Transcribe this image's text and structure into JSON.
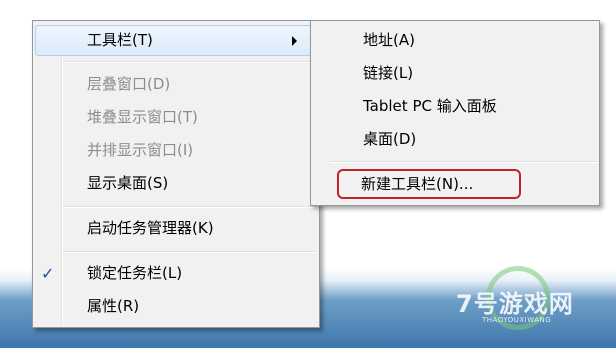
{
  "context_menu": {
    "toolbars": {
      "label": "工具栏(T)",
      "has_submenu": true
    },
    "cascade_windows": {
      "label": "层叠窗口(D)",
      "disabled": true
    },
    "stack_windows": {
      "label": "堆叠显示窗口(T)",
      "disabled": true
    },
    "side_by_side": {
      "label": "并排显示窗口(I)",
      "disabled": true
    },
    "show_desktop": {
      "label": "显示桌面(S)"
    },
    "task_manager": {
      "label": "启动任务管理器(K)"
    },
    "lock_taskbar": {
      "label": "锁定任务栏(L)",
      "check": "✓"
    },
    "properties": {
      "label": "属性(R)"
    }
  },
  "toolbars_submenu": {
    "address": {
      "label": "地址(A)"
    },
    "links": {
      "label": "链接(L)"
    },
    "tablet_input": {
      "label": "Tablet PC 输入面板"
    },
    "desktop": {
      "label": "桌面(D)"
    },
    "new_toolbar": {
      "label": "新建工具栏(N)..."
    }
  },
  "watermark": {
    "text": "7号游戏网",
    "subtext": "THAOYOUXIWANG"
  },
  "colors": {
    "menu_bg": "#f1f1f1",
    "highlight_border": "#aecff7",
    "annotation_red": "#c0232a",
    "disabled_text": "#8d8d8d"
  }
}
